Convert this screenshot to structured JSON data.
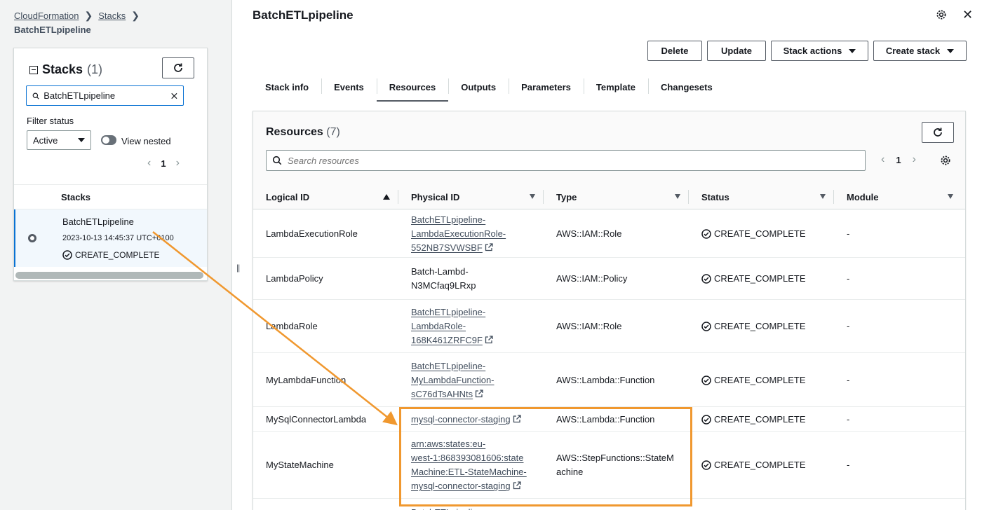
{
  "breadcrumb": {
    "root": "CloudFormation",
    "stacks": "Stacks",
    "current": "BatchETLpipeline"
  },
  "stacks_panel": {
    "title": "Stacks",
    "count": "(1)",
    "search_value": "BatchETLpipeline",
    "filter_label": "Filter status",
    "filter_value": "Active",
    "view_nested": "View nested",
    "page": "1",
    "column": "Stacks",
    "selected_stack": {
      "name": "BatchETLpipeline",
      "time": "2023-10-13 14:45:37 UTC+0100",
      "status": "CREATE_COMPLETE"
    }
  },
  "main": {
    "title": "BatchETLpipeline",
    "buttons": {
      "delete": "Delete",
      "update": "Update",
      "stack_actions": "Stack actions",
      "create_stack": "Create stack"
    },
    "tabs": [
      "Stack info",
      "Events",
      "Resources",
      "Outputs",
      "Parameters",
      "Template",
      "Changesets"
    ],
    "active_tab": "Resources"
  },
  "resources": {
    "title": "Resources",
    "count": "(7)",
    "search_placeholder": "Search resources",
    "page": "1",
    "columns": [
      "Logical ID",
      "Physical ID",
      "Type",
      "Status",
      "Module"
    ],
    "rows": [
      {
        "logical": "LambdaExecutionRole",
        "physical": [
          "BatchETLpipeline-",
          "LambdaExecutionRole-",
          "552NB7SVWSBF"
        ],
        "link": true,
        "type": [
          "AWS::IAM::Role"
        ],
        "status": "CREATE_COMPLETE",
        "module": "-"
      },
      {
        "logical": "LambdaPolicy",
        "physical": [
          "Batch-Lambd-",
          "N3MCfaq9LRxp"
        ],
        "link": false,
        "type": [
          "AWS::IAM::Policy"
        ],
        "status": "CREATE_COMPLETE",
        "module": "-"
      },
      {
        "logical": "LambdaRole",
        "physical": [
          "BatchETLpipeline-",
          "LambdaRole-",
          "168K461ZRFC9F"
        ],
        "link": true,
        "type": [
          "AWS::IAM::Role"
        ],
        "status": "CREATE_COMPLETE",
        "module": "-"
      },
      {
        "logical": "MyLambdaFunction",
        "physical": [
          "BatchETLpipeline-",
          "MyLambdaFunction-",
          "sC76dTsAHNts"
        ],
        "link": true,
        "type": [
          "AWS::Lambda::Function"
        ],
        "status": "CREATE_COMPLETE",
        "module": "-"
      },
      {
        "logical": "MySqlConnectorLambda",
        "physical": [
          "mysql-connector-staging"
        ],
        "link": true,
        "type": [
          "AWS::Lambda::Function"
        ],
        "status": "CREATE_COMPLETE",
        "module": "-"
      },
      {
        "logical": "MyStateMachine",
        "physical": [
          "arn:aws:states:eu-",
          "west-1:868393081606:state",
          "Machine:ETL-StateMachine-",
          "mysql-connector-staging"
        ],
        "link": true,
        "type": [
          "AWS::StepFunctions::StateM",
          "achine"
        ],
        "status": "CREATE_COMPLETE",
        "module": "-"
      },
      {
        "logical": "",
        "physical": [
          "BatchETLpipeline-"
        ],
        "link": true,
        "type": [
          ""
        ],
        "status": "",
        "module": ""
      }
    ]
  },
  "colors": {
    "highlight": "#f0982f",
    "link": "#414d5c",
    "border": "#d5dbdb"
  }
}
